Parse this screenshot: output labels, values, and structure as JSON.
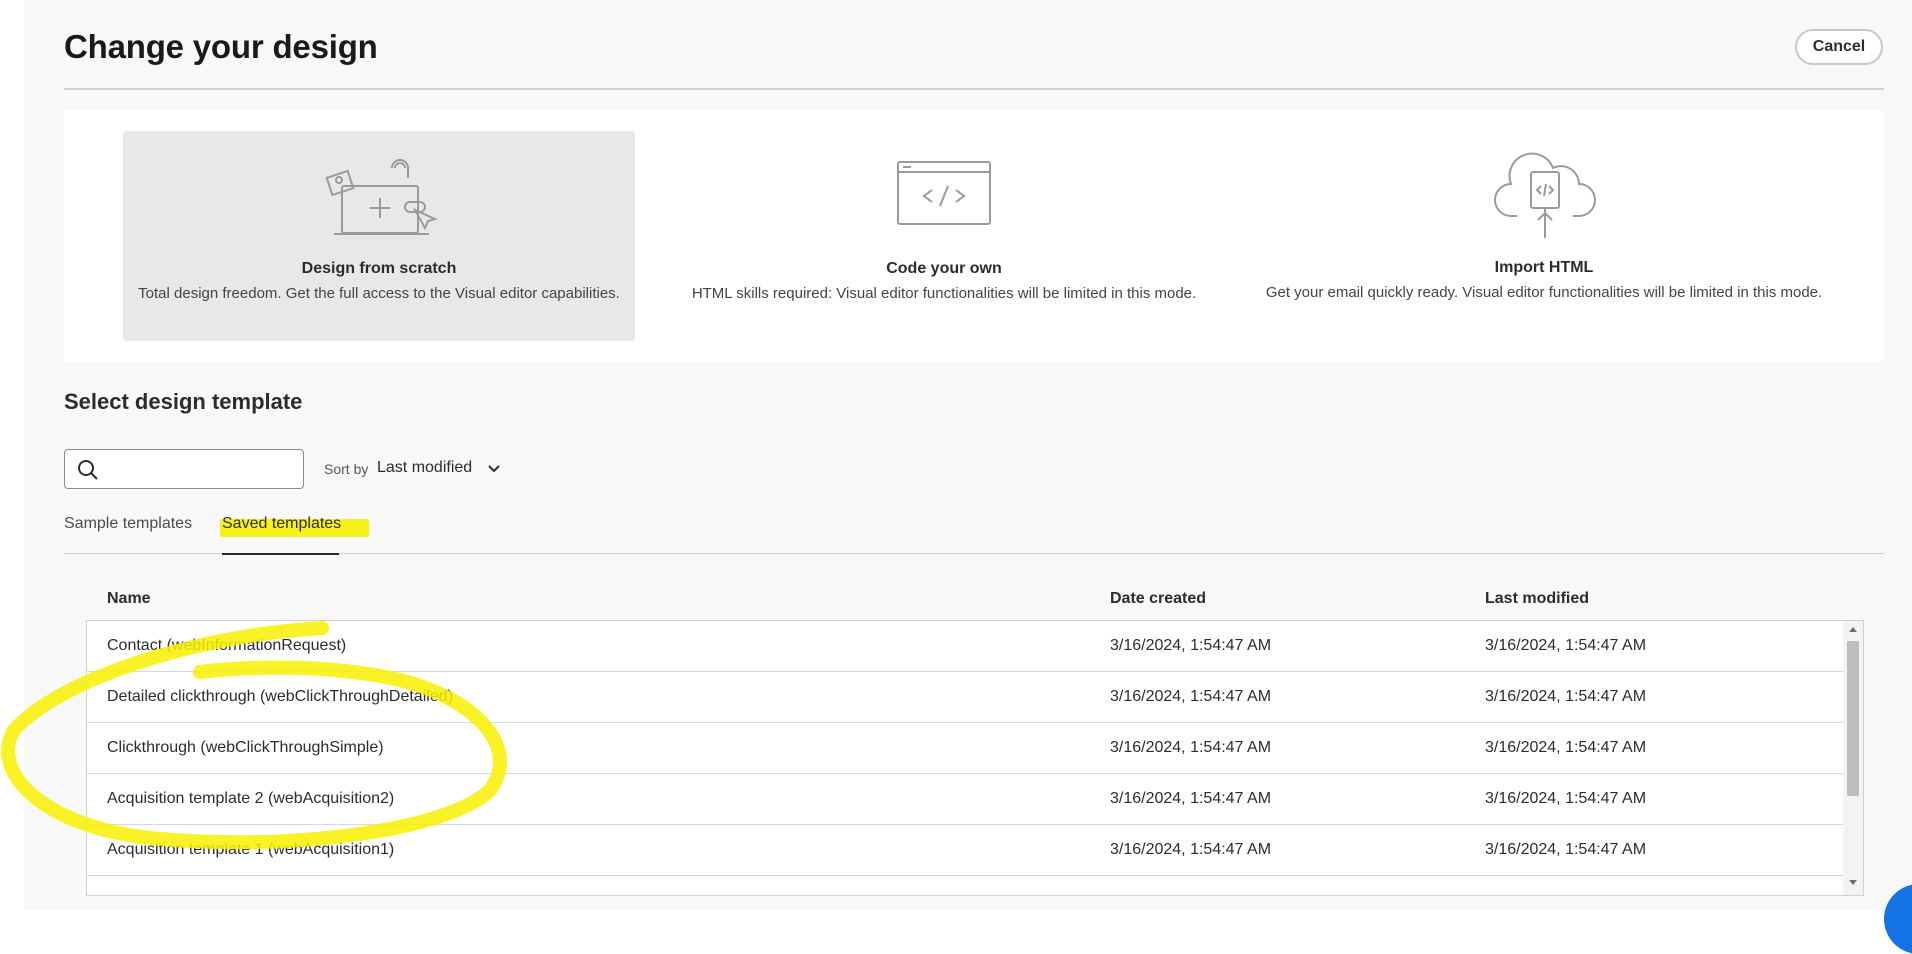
{
  "header": {
    "title": "Change your design",
    "cancel_label": "Cancel"
  },
  "design_options": [
    {
      "title": "Design from scratch",
      "description": "Total design freedom. Get the full access to the Visual editor capabilities.",
      "icon": "design-scratch-illustration",
      "selected": true
    },
    {
      "title": "Code your own",
      "description": "HTML skills required: Visual editor functionalities will be limited in this mode.",
      "icon": "code-window-illustration",
      "selected": false
    },
    {
      "title": "Import HTML",
      "description": "Get your email quickly ready. Visual editor functionalities will be limited in this mode.",
      "icon": "cloud-upload-illustration",
      "selected": false
    }
  ],
  "templates": {
    "section_title": "Select design template",
    "search": {
      "placeholder": "",
      "value": "",
      "icon": "search-icon"
    },
    "sort": {
      "label": "Sort by",
      "value": "Last modified",
      "icon": "chevron-down-icon"
    },
    "tabs": [
      {
        "label": "Sample templates",
        "active": false
      },
      {
        "label": "Saved templates",
        "active": true
      }
    ],
    "columns": [
      "Name",
      "Date created",
      "Last modified"
    ],
    "rows": [
      {
        "name": "Contact (webInformationRequest)",
        "created": "3/16/2024, 1:54:47 AM",
        "modified": "3/16/2024, 1:54:47 AM"
      },
      {
        "name": "Detailed clickthrough (webClickThroughDetailed)",
        "created": "3/16/2024, 1:54:47 AM",
        "modified": "3/16/2024, 1:54:47 AM"
      },
      {
        "name": "Clickthrough (webClickThroughSimple)",
        "created": "3/16/2024, 1:54:47 AM",
        "modified": "3/16/2024, 1:54:47 AM"
      },
      {
        "name": "Acquisition template 2 (webAcquisition2)",
        "created": "3/16/2024, 1:54:47 AM",
        "modified": "3/16/2024, 1:54:47 AM"
      },
      {
        "name": "Acquisition template 1 (webAcquisition1)",
        "created": "3/16/2024, 1:54:47 AM",
        "modified": "3/16/2024, 1:54:47 AM"
      }
    ]
  },
  "colors": {
    "annotation_highlight": "#f7f000",
    "accent_blue": "#1473e6",
    "selected_card": "#e8e8e8"
  }
}
